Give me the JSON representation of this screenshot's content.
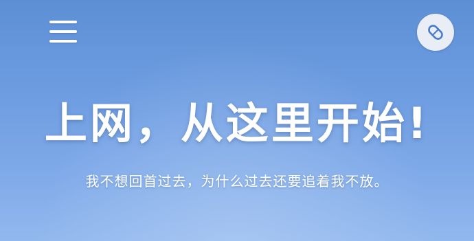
{
  "header": {
    "menu_icon": "hamburger-menu-icon",
    "compass_icon": "compass-icon"
  },
  "hero": {
    "title": "上网，从这里开始!",
    "subtitle": "我不想回首过去，为什么过去还要追着我不放。"
  },
  "colors": {
    "background_top": "#5d8fd4",
    "background_bottom": "#92b8ee",
    "compass_bg": "#e9eef6",
    "compass_accent": "#4a7bd0",
    "text": "#ffffff"
  }
}
